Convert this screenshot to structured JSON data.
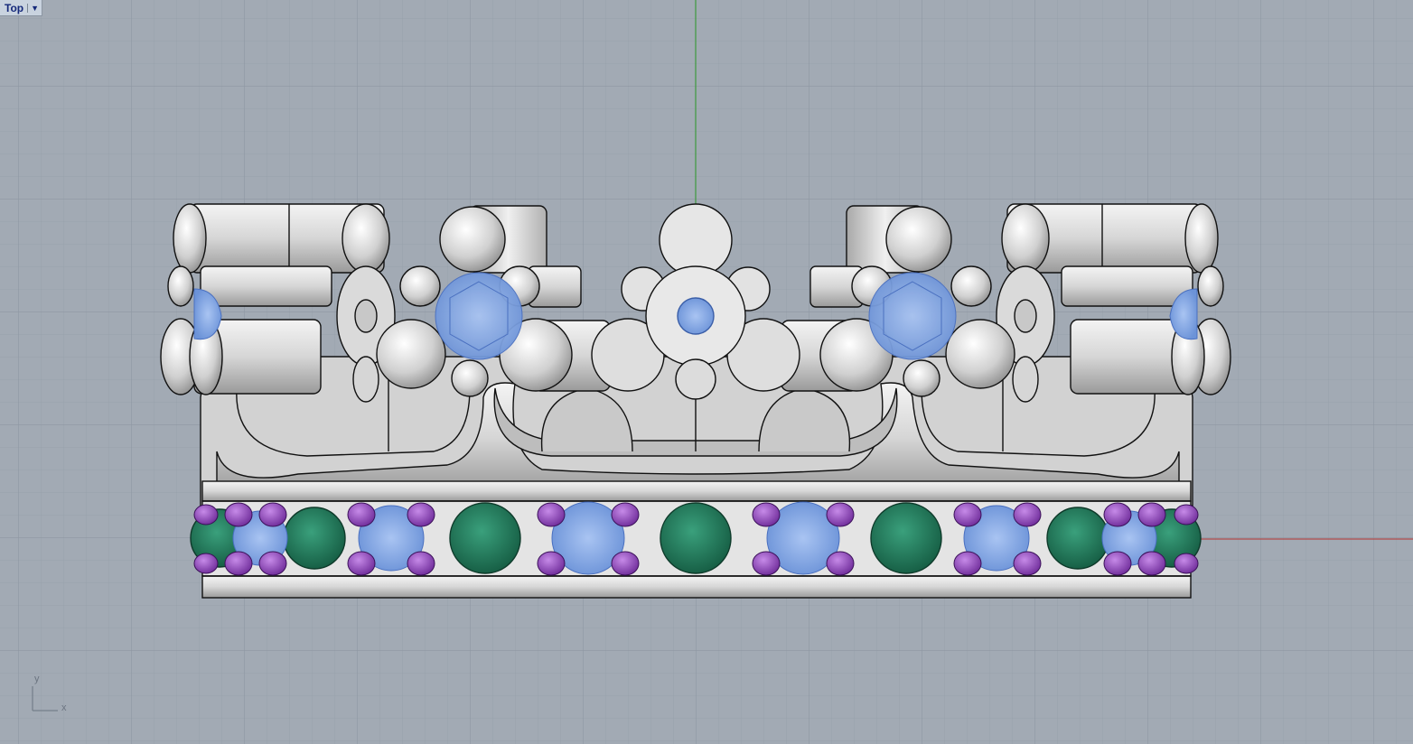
{
  "viewport": {
    "name": "Top",
    "menu_icon": "caret-down-icon"
  },
  "axis_widget": {
    "y_label": "y",
    "x_label": "x"
  },
  "colors": {
    "background": "#a2aab4",
    "grid_minor": "#98a1ab",
    "grid_major": "#8e97a2",
    "axis_y": "#3f9a3f",
    "axis_x": "#b14a4a",
    "metal": "#d8d8d8",
    "emerald": "#1f7a5c",
    "amethyst": "#8a3fbf",
    "blue_gem": "#8fb3ec"
  }
}
